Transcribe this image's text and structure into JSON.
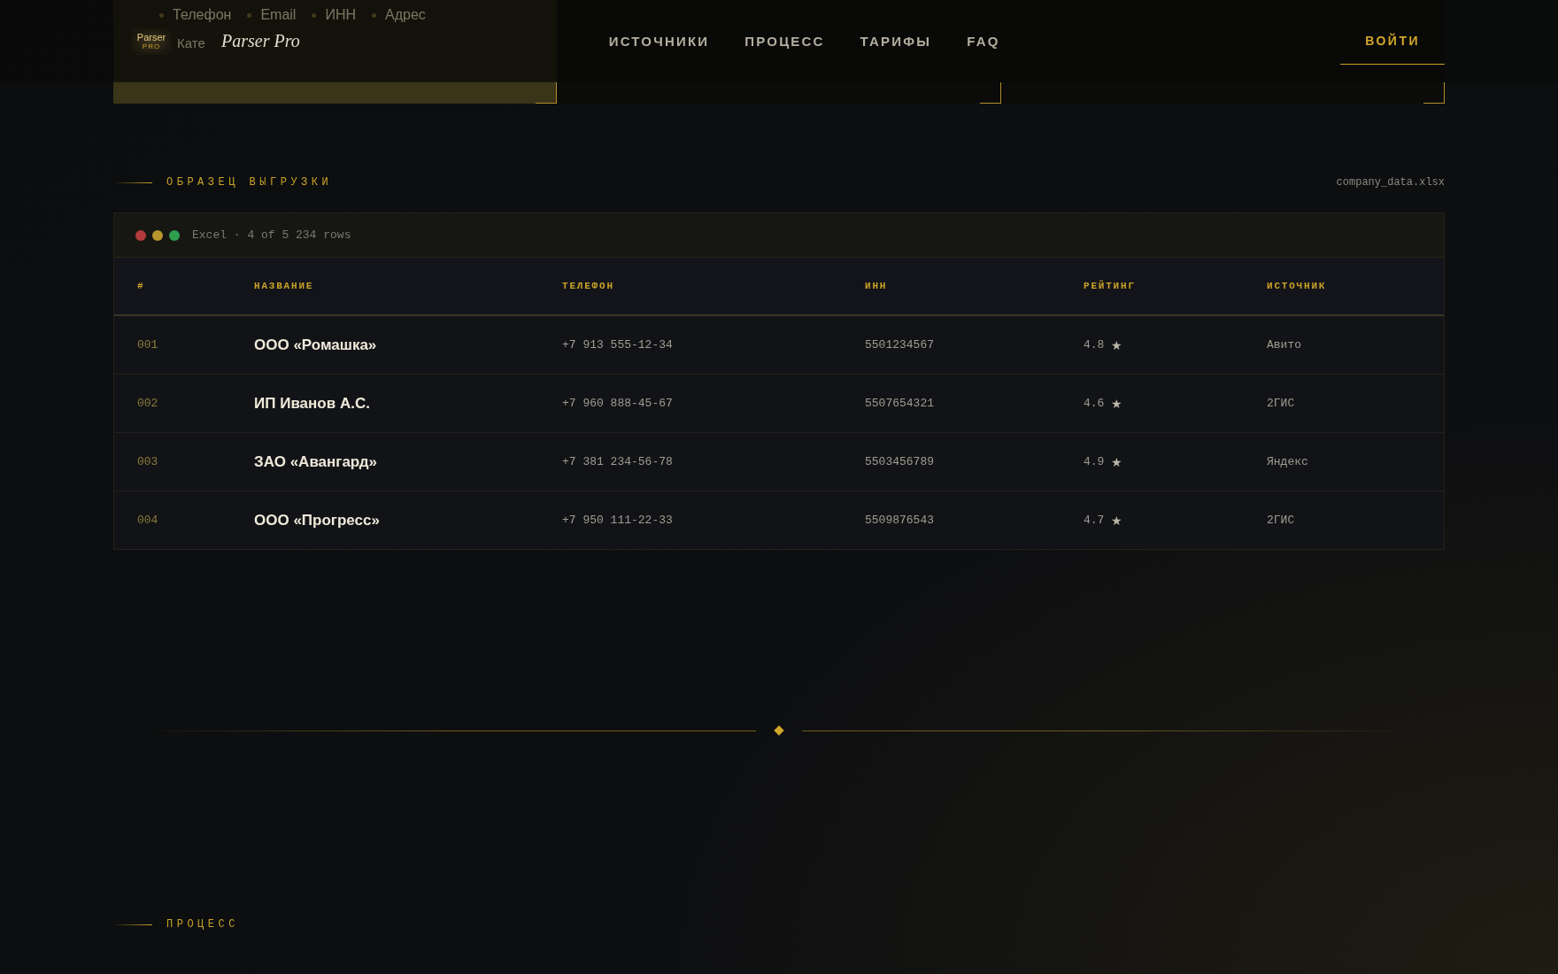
{
  "header": {
    "logo_badge": {
      "line1": "Parser",
      "line2": "PRO"
    },
    "brand": "Parser Pro",
    "nav": [
      "ИСТОЧНИКИ",
      "ПРОЦЕСС",
      "ТАРИФЫ",
      "FAQ"
    ],
    "login": "ВОЙТИ"
  },
  "hero_cards": [
    {
      "highlighted": true,
      "tags": [
        "Телефон",
        "Email",
        "ИНН",
        "Адрес"
      ],
      "cut_text": "Кате"
    },
    {
      "highlighted": false
    },
    {
      "highlighted": false
    }
  ],
  "sample": {
    "label": "ОБРАЗЕЦ ВЫГРУЗКИ",
    "file": "company_data.xlsx",
    "toolbar": {
      "dots": [
        {
          "color": "#b33a3a"
        },
        {
          "color": "#b8962e"
        },
        {
          "color": "#2e9e4f"
        }
      ],
      "caption": "Excel · 4 of 5 234 rows"
    },
    "columns": [
      "#",
      "НАЗВАНИЕ",
      "ТЕЛЕФОН",
      "ИНН",
      "РЕЙТИНГ",
      "ИСТОЧНИК"
    ],
    "rows": [
      {
        "num": "001",
        "name": "ООО «Ромашка»",
        "phone": "+7 913 555-12-34",
        "inn": "5501234567",
        "rating": "4.8",
        "star": "★",
        "source": "Авито"
      },
      {
        "num": "002",
        "name": "ИП Иванов А.С.",
        "phone": "+7 960 888-45-67",
        "inn": "5507654321",
        "rating": "4.6",
        "star": "★",
        "source": "2ГИС"
      },
      {
        "num": "003",
        "name": "ЗАО «Авангард»",
        "phone": "+7 381 234-56-78",
        "inn": "5503456789",
        "rating": "4.9",
        "star": "★",
        "source": "Яндекс"
      },
      {
        "num": "004",
        "name": "ООО «Прогресс»",
        "phone": "+7 950 111-22-33",
        "inn": "5509876543",
        "rating": "4.7",
        "star": "★",
        "source": "2ГИС"
      }
    ]
  },
  "next_section": {
    "label": "ПРОЦЕСС"
  }
}
